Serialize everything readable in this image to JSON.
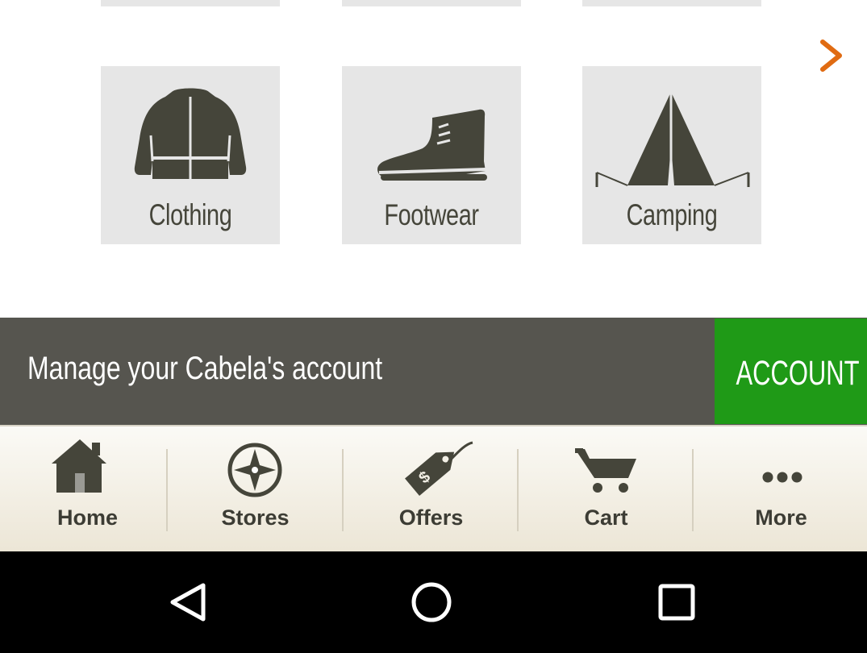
{
  "categories": [
    {
      "label": "Clothing",
      "icon": "jacket-icon"
    },
    {
      "label": "Footwear",
      "icon": "boot-icon"
    },
    {
      "label": "Camping",
      "icon": "tent-icon"
    }
  ],
  "next_icon": "chevron-right-icon",
  "account_bar": {
    "message": "Manage your Cabela's account",
    "button_label": "ACCOUNT"
  },
  "tabs": [
    {
      "label": "Home",
      "icon": "home-icon"
    },
    {
      "label": "Stores",
      "icon": "compass-icon"
    },
    {
      "label": "Offers",
      "icon": "price-tag-icon"
    },
    {
      "label": "Cart",
      "icon": "cart-icon"
    },
    {
      "label": "More",
      "icon": "more-icon"
    }
  ],
  "system_nav": [
    "back-icon",
    "home-circle-icon",
    "recents-icon"
  ],
  "colors": {
    "accent_orange": "#e06b12",
    "account_green": "#1f9a17",
    "bar_gray": "#56554f",
    "icon_olive": "#45453a"
  }
}
